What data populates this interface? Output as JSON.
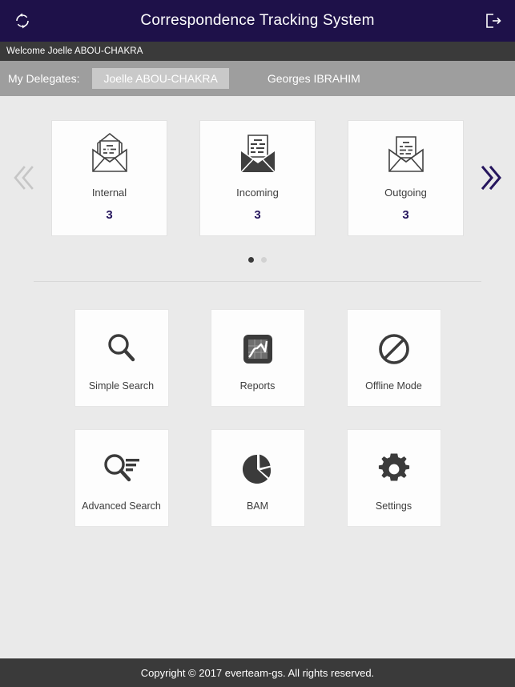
{
  "header": {
    "title": "Correspondence Tracking System",
    "refresh_icon": "refresh-icon",
    "logout_icon": "logout-icon",
    "background": "#1e1149"
  },
  "welcome": {
    "text": "Welcome Joelle ABOU-CHAKRA",
    "background": "#3a3a3a"
  },
  "delegates": {
    "label": "My Delegates:",
    "background": "#9e9e9e",
    "items": [
      {
        "name": "Joelle ABOU-CHAKRA",
        "selected": true
      },
      {
        "name": "Georges IBRAHIM",
        "selected": false
      }
    ]
  },
  "carousel": {
    "prev_icon": "double-chevron-left-icon",
    "next_icon": "double-chevron-right-icon",
    "prev_enabled": false,
    "next_enabled": true,
    "prev_color": "#c6c6c6",
    "next_color": "#26165e",
    "count_color": "#26165e",
    "cards": [
      {
        "label": "Internal",
        "count": "3",
        "icon": "envelope-open-outline-icon"
      },
      {
        "label": "Incoming",
        "count": "3",
        "icon": "envelope-incoming-filled-icon"
      },
      {
        "label": "Outgoing",
        "count": "3",
        "icon": "envelope-outgoing-outline-icon"
      }
    ],
    "page_dots": [
      {
        "active": true
      },
      {
        "active": false
      }
    ]
  },
  "actions": {
    "rows": [
      [
        {
          "label": "Simple Search",
          "icon": "magnifier-icon"
        },
        {
          "label": "Reports",
          "icon": "chart-report-icon"
        },
        {
          "label": "Offline Mode",
          "icon": "no-entry-icon"
        }
      ],
      [
        {
          "label": "Advanced Search",
          "icon": "magnifier-lines-icon"
        },
        {
          "label": "BAM",
          "icon": "pie-chart-icon"
        },
        {
          "label": "Settings",
          "icon": "gear-icon"
        }
      ]
    ]
  },
  "footer": {
    "text": "Copyright © 2017 everteam-gs. All rights reserved.",
    "background": "#3a3a3a"
  }
}
